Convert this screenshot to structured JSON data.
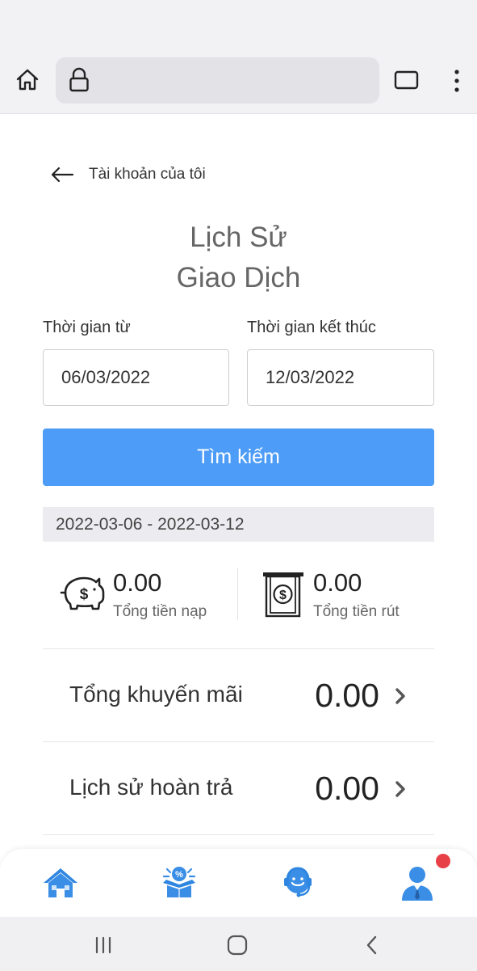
{
  "browser": {
    "home_icon": "home-icon",
    "lock_icon": "lock-icon",
    "tabs_icon": "tabs-icon",
    "menu_icon": "more-vert-icon"
  },
  "page": {
    "back_label": "Tài khoản của tôi",
    "title_line1": "Lịch Sử",
    "title_line2": "Giao Dịch",
    "from_label": "Thời gian từ",
    "to_label": "Thời gian kết thúc",
    "from_value": "06/03/2022",
    "to_value": "12/03/2022",
    "search_label": "Tìm kiếm",
    "range_text": "2022-03-06 - 2022-03-12",
    "deposit": {
      "value": "0.00",
      "label": "Tổng tiền nạp",
      "icon": "piggy-bank-icon"
    },
    "withdraw": {
      "value": "0.00",
      "label": "Tổng tiền rút",
      "icon": "cash-withdraw-icon"
    },
    "rows": [
      {
        "label": "Tổng khuyến mãi",
        "value": "0.00"
      },
      {
        "label": "Lịch sử hoàn trả",
        "value": "0.00"
      }
    ]
  },
  "bottom_nav": {
    "items": [
      "home-icon",
      "promotion-icon",
      "support-icon",
      "account-icon"
    ],
    "accent": "#3a8ee6",
    "badge_color": "#e84047"
  },
  "system_nav": [
    "recents-icon",
    "home-circle-icon",
    "back-icon"
  ],
  "colors": {
    "primary_button": "#4d9cf8"
  }
}
